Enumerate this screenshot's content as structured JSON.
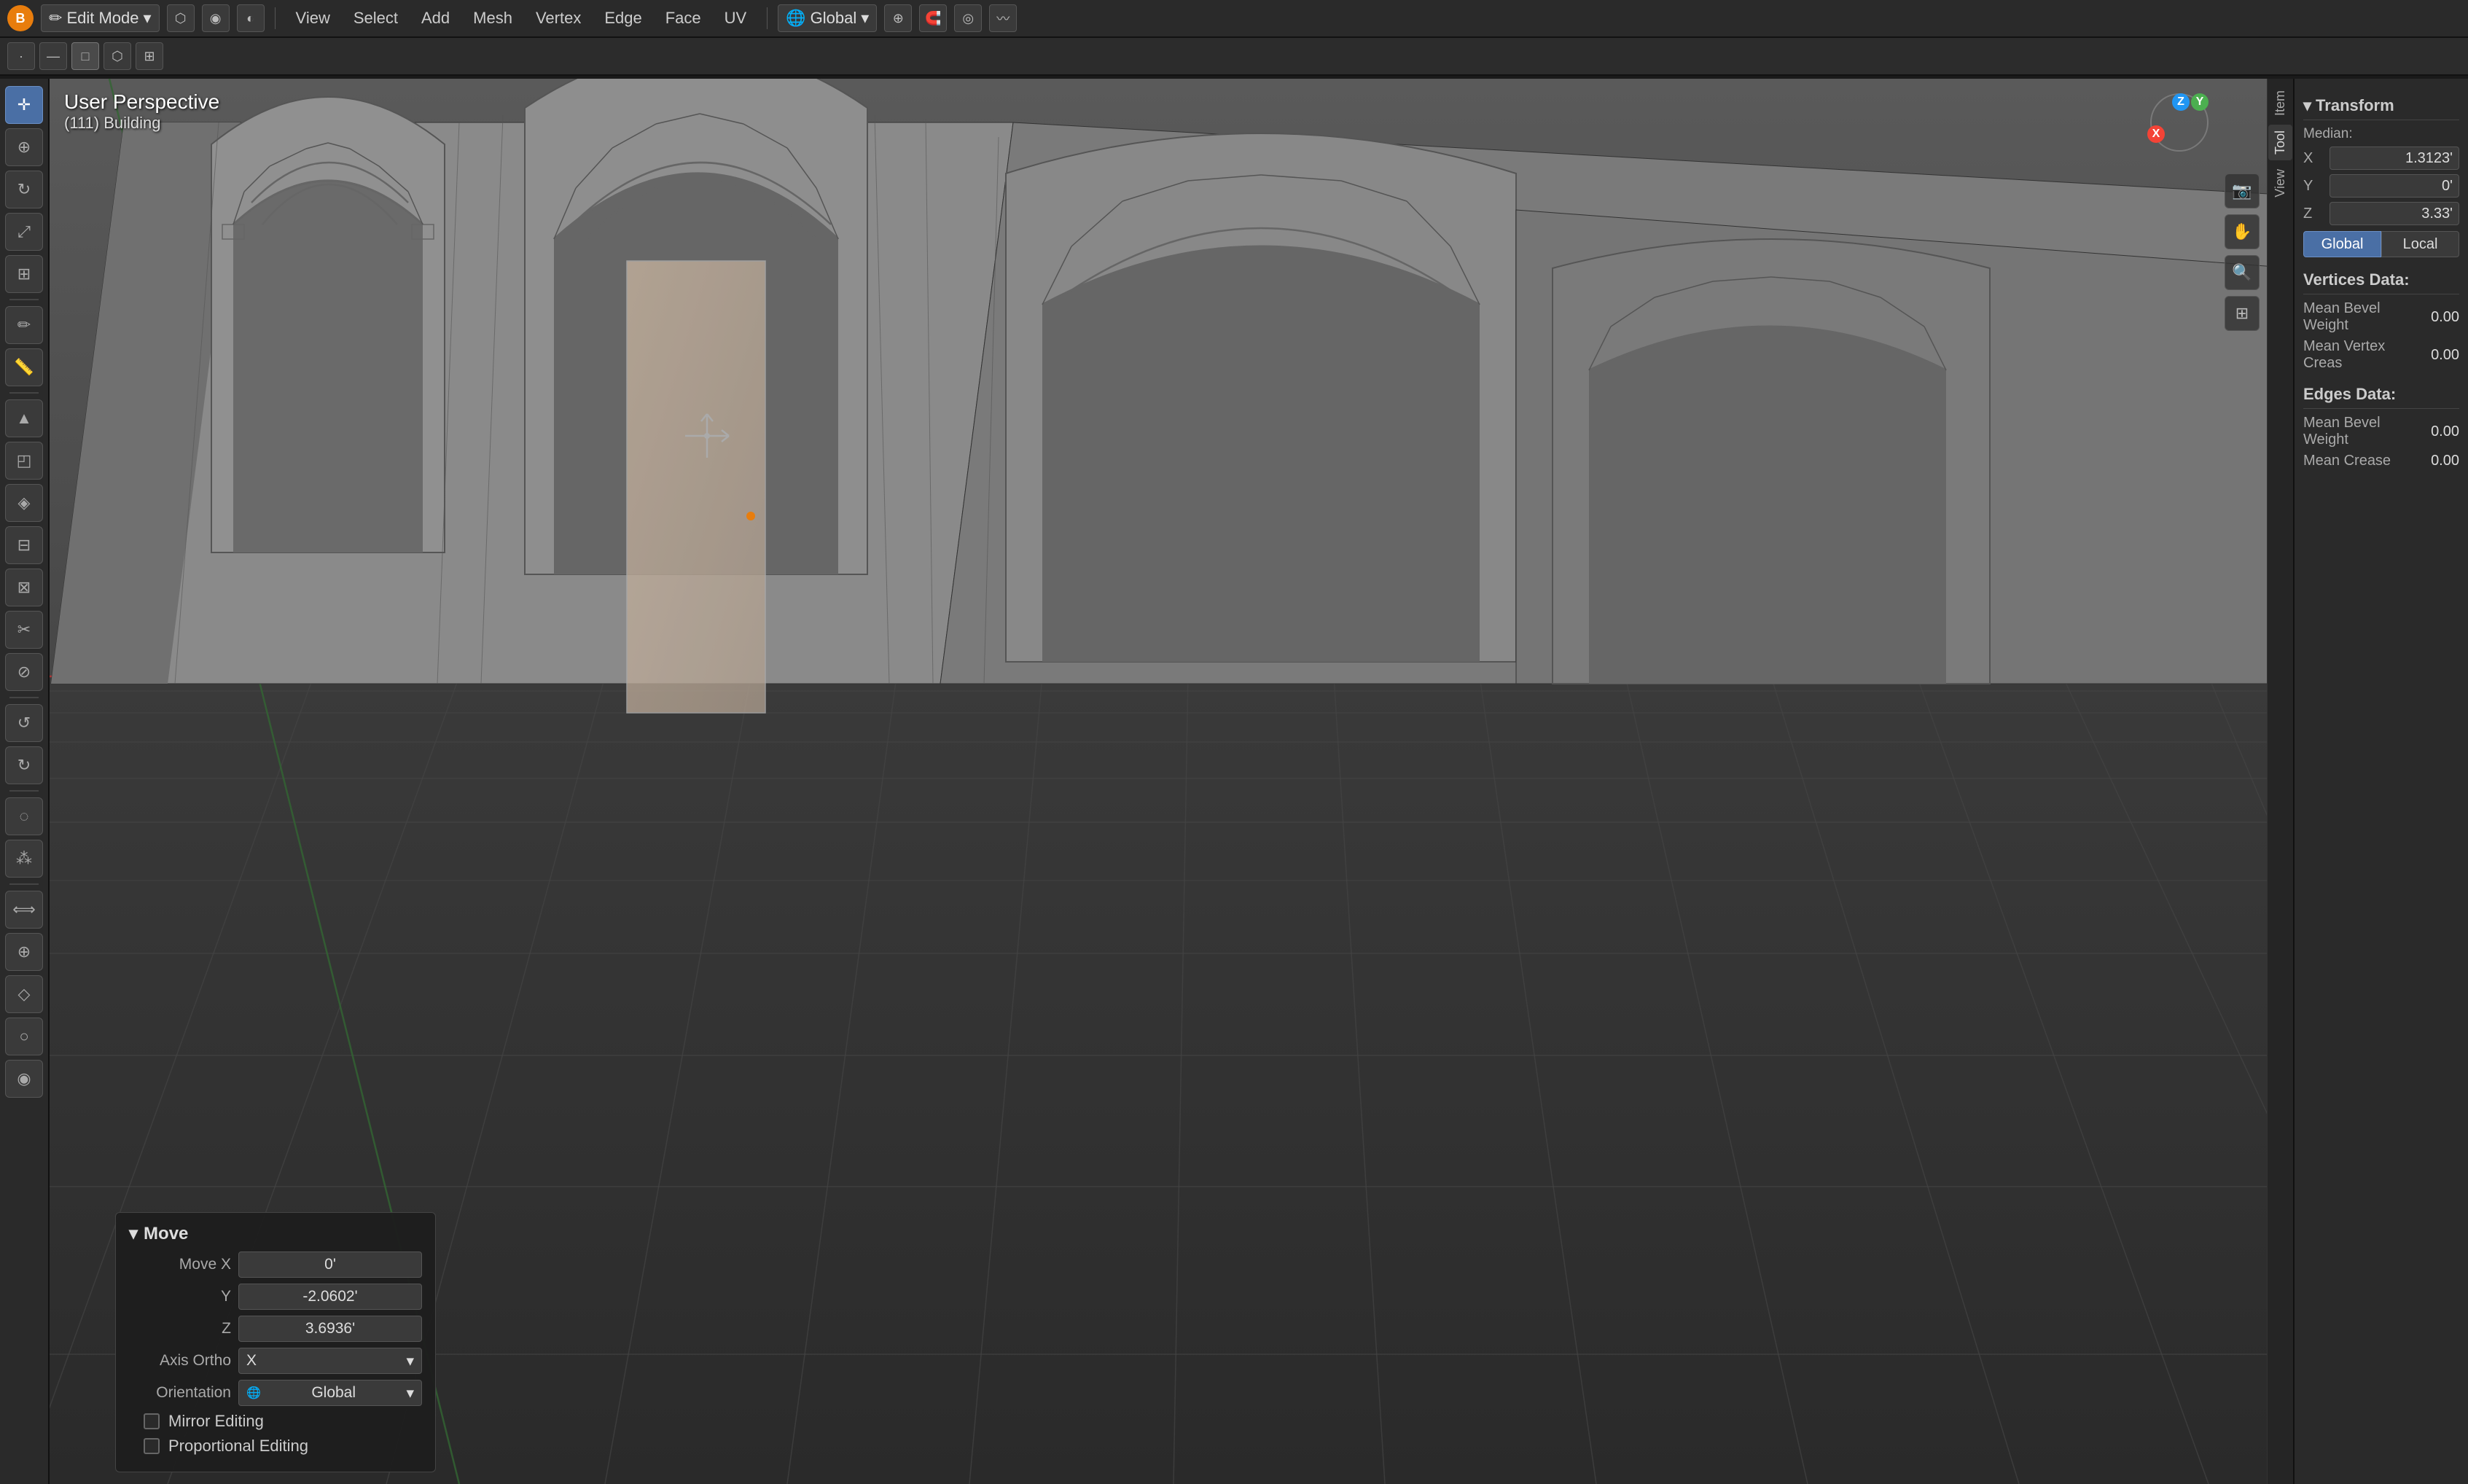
{
  "app": {
    "title": "Blender",
    "logo": "B"
  },
  "top_bar": {
    "mode": "Edit Mode",
    "mode_icon": "✏",
    "header_icons": [
      "□",
      "□",
      "□"
    ],
    "menu_items": [
      "View",
      "Select",
      "Add",
      "Mesh",
      "Vertex",
      "Edge",
      "Face",
      "UV"
    ],
    "transform_label": "Global",
    "snapping_label": "Snap",
    "proportional_label": "Proportional"
  },
  "second_bar": {
    "mode_icons": [
      "▣",
      "▣",
      "▣",
      "▣",
      "▣"
    ]
  },
  "viewport": {
    "perspective_label": "User Perspective",
    "object_label": "(111) Building",
    "gizmo": {
      "x_label": "X",
      "y_label": "Y",
      "z_label": "Z"
    }
  },
  "left_toolbar": {
    "tools": [
      {
        "icon": "✛",
        "label": "cursor-tool"
      },
      {
        "icon": "⟳",
        "label": "move-tool",
        "active": true
      },
      {
        "icon": "↻",
        "label": "rotate-tool"
      },
      {
        "icon": "⤢",
        "label": "scale-tool"
      },
      {
        "icon": "⊞",
        "label": "transform-tool"
      },
      {
        "icon": "◰",
        "label": "annotate-tool"
      },
      {
        "icon": "◌",
        "label": "measure-tool"
      },
      {
        "icon": "⬡",
        "label": "add-cube-tool"
      },
      {
        "icon": "⬡",
        "label": "extrude-tool"
      },
      {
        "icon": "↑",
        "label": "inset-tool"
      },
      {
        "icon": "⊗",
        "label": "bevel-tool"
      },
      {
        "icon": "✂",
        "label": "loop-cut-tool"
      },
      {
        "icon": "⊕",
        "label": "knife-tool"
      },
      {
        "icon": "⬠",
        "label": "poly-build-tool"
      },
      {
        "icon": "◈",
        "label": "spin-tool"
      },
      {
        "icon": "⊙",
        "label": "smooth-tool"
      },
      {
        "icon": "⊕",
        "label": "edge-slide-tool"
      },
      {
        "icon": "⊡",
        "label": "shrink-tool"
      },
      {
        "icon": "◕",
        "label": "shear-tool"
      },
      {
        "icon": "◉",
        "label": "rip-tool"
      }
    ]
  },
  "right_panel": {
    "tab_active": "Tool",
    "tabs": [
      "Tool",
      "View",
      "Item"
    ],
    "transform_section": {
      "title": "Transform",
      "median_label": "Median:",
      "x_label": "X",
      "x_value": "1.3123'",
      "y_label": "Y",
      "y_value": "0'",
      "z_label": "Z",
      "z_value": "3.33'",
      "global_btn": "Global",
      "local_btn": "Local"
    },
    "vertices_data": {
      "title": "Vertices Data:",
      "mean_bevel_weight_label": "Mean Bevel Weight",
      "mean_bevel_weight_value": "0.00",
      "mean_vertex_crease_label": "Mean Vertex Creas",
      "mean_vertex_crease_value": "0.00"
    },
    "edges_data": {
      "title": "Edges Data:",
      "mean_bevel_weight_label": "Mean Bevel Weight",
      "mean_bevel_weight_value": "0.00",
      "mean_crease_label": "Mean Crease",
      "mean_crease_value": "0.00"
    }
  },
  "bottom_panel": {
    "title": "Move",
    "move_x_label": "Move X",
    "move_x_value": "0'",
    "y_label": "Y",
    "y_value": "-2.0602'",
    "z_label": "Z",
    "z_value": "3.6936'",
    "axis_ortho_label": "Axis Ortho",
    "axis_ortho_value": "X",
    "orientation_label": "Orientation",
    "orientation_value": "Global",
    "mirror_editing_label": "Mirror Editing",
    "mirror_editing_checked": false,
    "proportional_editing_label": "Proportional Editing",
    "proportional_editing_checked": false
  }
}
